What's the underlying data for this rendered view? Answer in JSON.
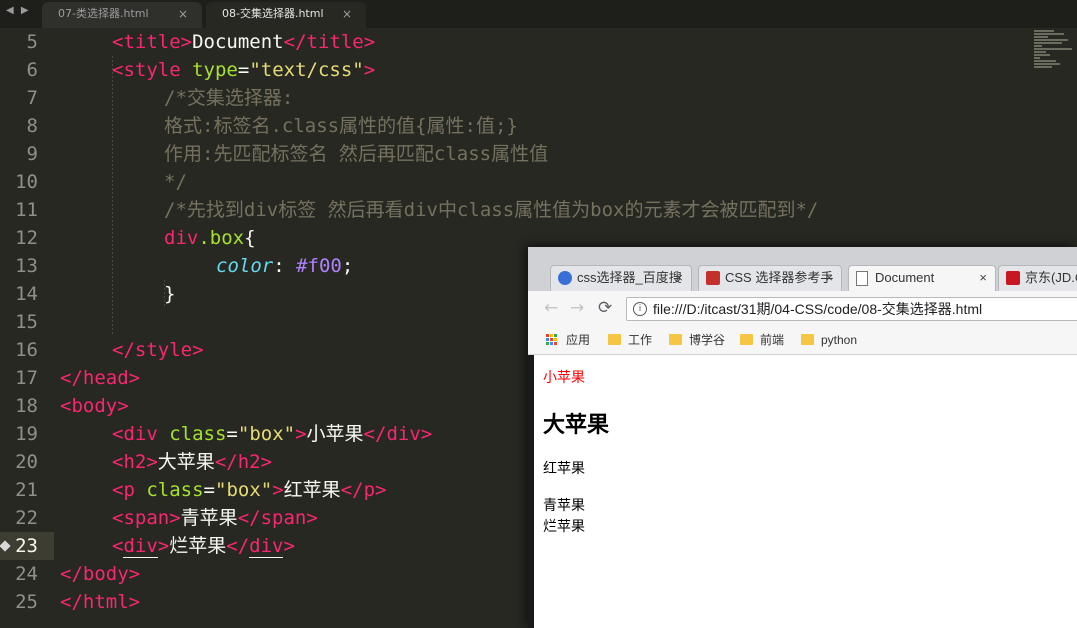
{
  "editor": {
    "nav": "◀ ▶",
    "tabs": [
      {
        "label": "07-类选择器.html",
        "close": "×"
      },
      {
        "label": "08-交集选择器.html",
        "close": "×"
      }
    ],
    "line_numbers": [
      "5",
      "6",
      "7",
      "8",
      "9",
      "10",
      "11",
      "12",
      "13",
      "14",
      "15",
      "16",
      "17",
      "18",
      "19",
      "20",
      "21",
      "22",
      "23",
      "24",
      "25"
    ],
    "current_line": "23"
  },
  "code": {
    "l5": {
      "t1": "<",
      "tag": "title",
      "t2": ">",
      "text": "Document",
      "t3": "</",
      "tag2": "title",
      "t4": ">"
    },
    "l6": {
      "t1": "<",
      "tag": "style",
      "attr": " type",
      "eq": "=",
      "val": "\"text/css\"",
      "t2": ">"
    },
    "l7": "/*交集选择器:",
    "l8": "格式:标签名.class属性的值{属性:值;}",
    "l9": "作用:先匹配标签名 然后再匹配class属性值",
    "l10": "*/",
    "l11": "/*先找到div标签 然后再看div中class属性值为box的元素才会被匹配到*/",
    "l12": {
      "tag": "div",
      "cls": ".box",
      "brace": "{"
    },
    "l13": {
      "prop": "color",
      "colon": ": ",
      "val": "#f00",
      "semi": ";"
    },
    "l14": "}",
    "l16": {
      "t1": "</",
      "tag": "style",
      "t2": ">"
    },
    "l17": {
      "t1": "</",
      "tag": "head",
      "t2": ">"
    },
    "l18": {
      "t1": "<",
      "tag": "body",
      "t2": ">"
    },
    "l19": {
      "t1": "<",
      "tag": "div",
      "attr": " class",
      "eq": "=",
      "val": "\"box\"",
      "t2": ">",
      "text": "小苹果",
      "t3": "</",
      "tag2": "div",
      "t4": ">"
    },
    "l20": {
      "t1": "<",
      "tag": "h2",
      "t2": ">",
      "text": "大苹果",
      "t3": "</",
      "tag2": "h2",
      "t4": ">"
    },
    "l21": {
      "t1": "<",
      "tag": "p",
      "attr": " class",
      "eq": "=",
      "val": "\"box\"",
      "t2": ">",
      "text": "红苹果",
      "t3": "</",
      "tag2": "p",
      "t4": ">"
    },
    "l22": {
      "t1": "<",
      "tag": "span",
      "t2": ">",
      "text": "青苹果",
      "t3": "</",
      "tag2": "span",
      "t4": ">"
    },
    "l23": {
      "t1": "<",
      "tag": "div",
      "t2": ">",
      "text": "烂苹果",
      "t3": "</",
      "tag2": "div",
      "t4": ">"
    },
    "l24": {
      "t1": "</",
      "tag": "body",
      "t2": ">"
    },
    "l25": {
      "t1": "</",
      "tag": "html",
      "t2": ">"
    }
  },
  "browser": {
    "tabs": [
      {
        "label": "css选择器_百度搜",
        "close": "×",
        "icon": "baidu-paw-icon"
      },
      {
        "label": "CSS 选择器参考手",
        "close": "×",
        "icon": "w3school-icon"
      },
      {
        "label": "Document",
        "close": "×",
        "icon": "page-icon"
      },
      {
        "label": "京东(JD.COM)",
        "close": "×",
        "icon": "jd-icon"
      }
    ],
    "back": "←",
    "forward": "→",
    "reload": "⟳",
    "info": "i",
    "url": "file:///D:/itcast/31期/04-CSS/code/08-交集选择器.html",
    "bookmarks": [
      "应用",
      "工作",
      "博学谷",
      "前端",
      "python"
    ],
    "content": {
      "div_box": "小苹果",
      "h2": "大苹果",
      "p_box": "红苹果",
      "span": "青苹果",
      "div": "烂苹果"
    },
    "colors": {
      "red_text": "#ff0000"
    }
  }
}
